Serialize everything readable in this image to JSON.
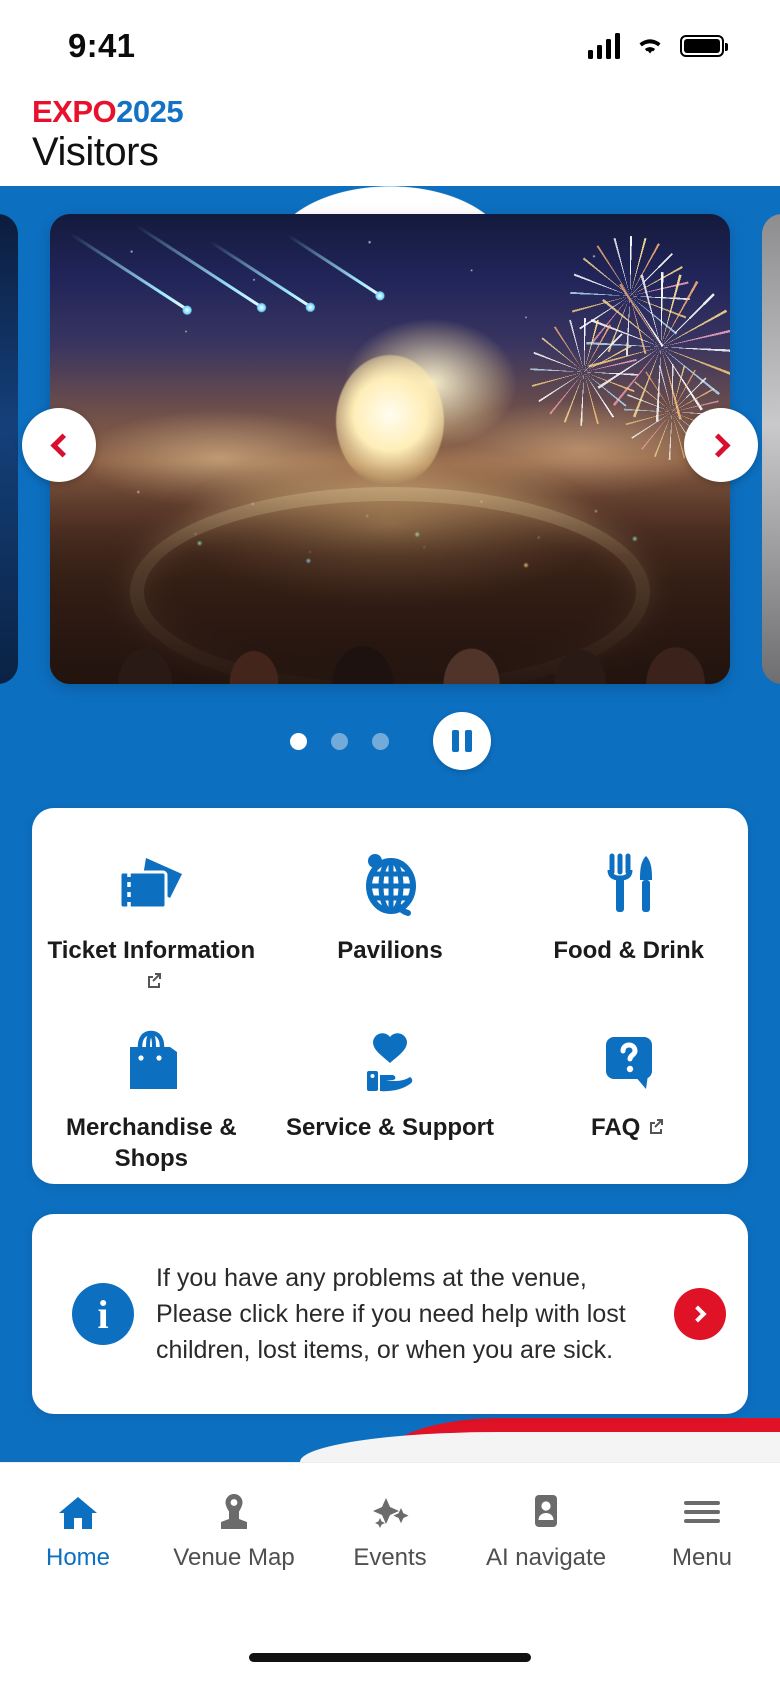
{
  "status_bar": {
    "time": "9:41",
    "signal_icon": "cellular-signal-icon",
    "wifi_icon": "wifi-icon",
    "battery_icon": "battery-icon"
  },
  "brand": {
    "expo": "EXPO",
    "year": "2025",
    "subtitle": "Visitors"
  },
  "carousel": {
    "slides": [
      {
        "name": "expo-night-fireworks",
        "alt": "Aerial night view of Expo site with fireworks and crowd"
      },
      {
        "name": "slide-previous",
        "alt": "Previous slide preview"
      },
      {
        "name": "slide-next",
        "alt": "Next slide preview"
      }
    ],
    "prev_label": "Previous",
    "next_label": "Next",
    "dots": [
      "1",
      "2",
      "3"
    ],
    "active_dot_index": 0,
    "pause_label": "Pause"
  },
  "quick_links": [
    {
      "label": "Ticket Information",
      "icon": "ticket-icon",
      "external": true
    },
    {
      "label": "Pavilions",
      "icon": "globe-icon",
      "external": false
    },
    {
      "label": "Food & Drink",
      "icon": "fork-knife-icon",
      "external": false
    },
    {
      "label": "Merchandise & Shops",
      "icon": "shopping-bag-icon",
      "external": false
    },
    {
      "label": "Service & Support",
      "icon": "hand-heart-icon",
      "external": false
    },
    {
      "label": "FAQ",
      "icon": "question-bubble-icon",
      "external": true
    }
  ],
  "info_banner": {
    "icon": "info-icon",
    "text": "If you have any problems at the venue, Please click here if you need help with lost children, lost items, or when you are sick.",
    "go_icon": "chevron-right-icon"
  },
  "tabbar": [
    {
      "label": "Home",
      "icon": "home-icon",
      "active": true
    },
    {
      "label": "Venue Map",
      "icon": "map-pin-icon",
      "active": false
    },
    {
      "label": "Events",
      "icon": "fireworks-star-icon",
      "active": false
    },
    {
      "label": "AI navigate",
      "icon": "person-badge-icon",
      "active": false
    },
    {
      "label": "Menu",
      "icon": "hamburger-menu-icon",
      "active": false
    }
  ],
  "colors": {
    "brand_blue": "#0d6fc0",
    "brand_red": "#e8112d",
    "accent_red": "#e01226",
    "text_dark": "#1b1b1b"
  }
}
